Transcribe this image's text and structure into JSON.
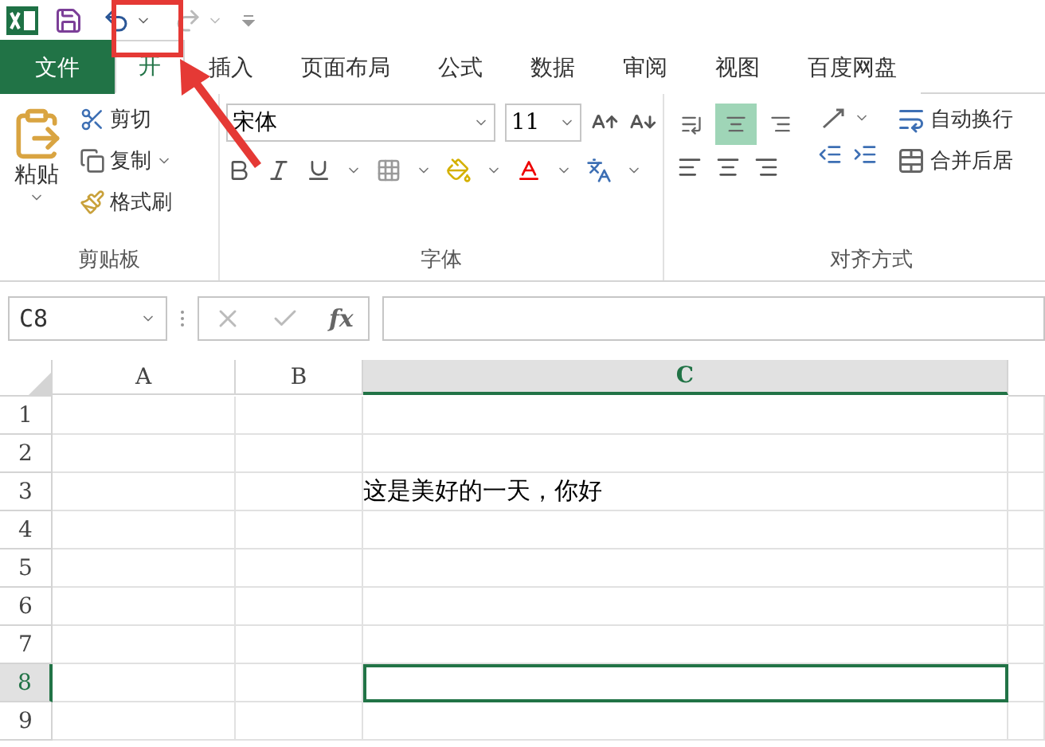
{
  "tabs": [
    {
      "label": "文件",
      "kind": "file",
      "selected": false
    },
    {
      "label": "开",
      "kind": "tab",
      "selected": true
    },
    {
      "label": "插入",
      "kind": "tab",
      "selected": false
    },
    {
      "label": "页面布局",
      "kind": "tab",
      "selected": false
    },
    {
      "label": "公式",
      "kind": "tab",
      "selected": false
    },
    {
      "label": "数据",
      "kind": "tab",
      "selected": false
    },
    {
      "label": "审阅",
      "kind": "tab",
      "selected": false
    },
    {
      "label": "视图",
      "kind": "tab",
      "selected": false
    },
    {
      "label": "百度网盘",
      "kind": "tab",
      "selected": false
    }
  ],
  "clipboard": {
    "paste": "粘贴",
    "cut": "剪切",
    "copy": "复制",
    "painter": "格式刷",
    "title": "剪贴板"
  },
  "font": {
    "name": "宋体",
    "size": "11",
    "title": "字体"
  },
  "alignment": {
    "vertical": [
      {
        "selected": false
      },
      {
        "selected": true
      },
      {
        "selected": false
      }
    ],
    "wrap": "自动换行",
    "merge": "合并后居",
    "title": "对齐方式"
  },
  "name_box": "C8",
  "formula_button": "fx",
  "columns": [
    {
      "label": "A",
      "selected": false
    },
    {
      "label": "B",
      "selected": false
    },
    {
      "label": "C",
      "selected": true
    }
  ],
  "rows": [
    {
      "header": "1",
      "selected": false
    },
    {
      "header": "2",
      "selected": false
    },
    {
      "header": "3",
      "selected": false,
      "c": "这是美好的一天，你好"
    },
    {
      "header": "4",
      "selected": false
    },
    {
      "header": "5",
      "selected": false
    },
    {
      "header": "6",
      "selected": false
    },
    {
      "header": "7",
      "selected": false
    },
    {
      "header": "8",
      "selected": true
    },
    {
      "header": "9",
      "selected": false
    }
  ]
}
